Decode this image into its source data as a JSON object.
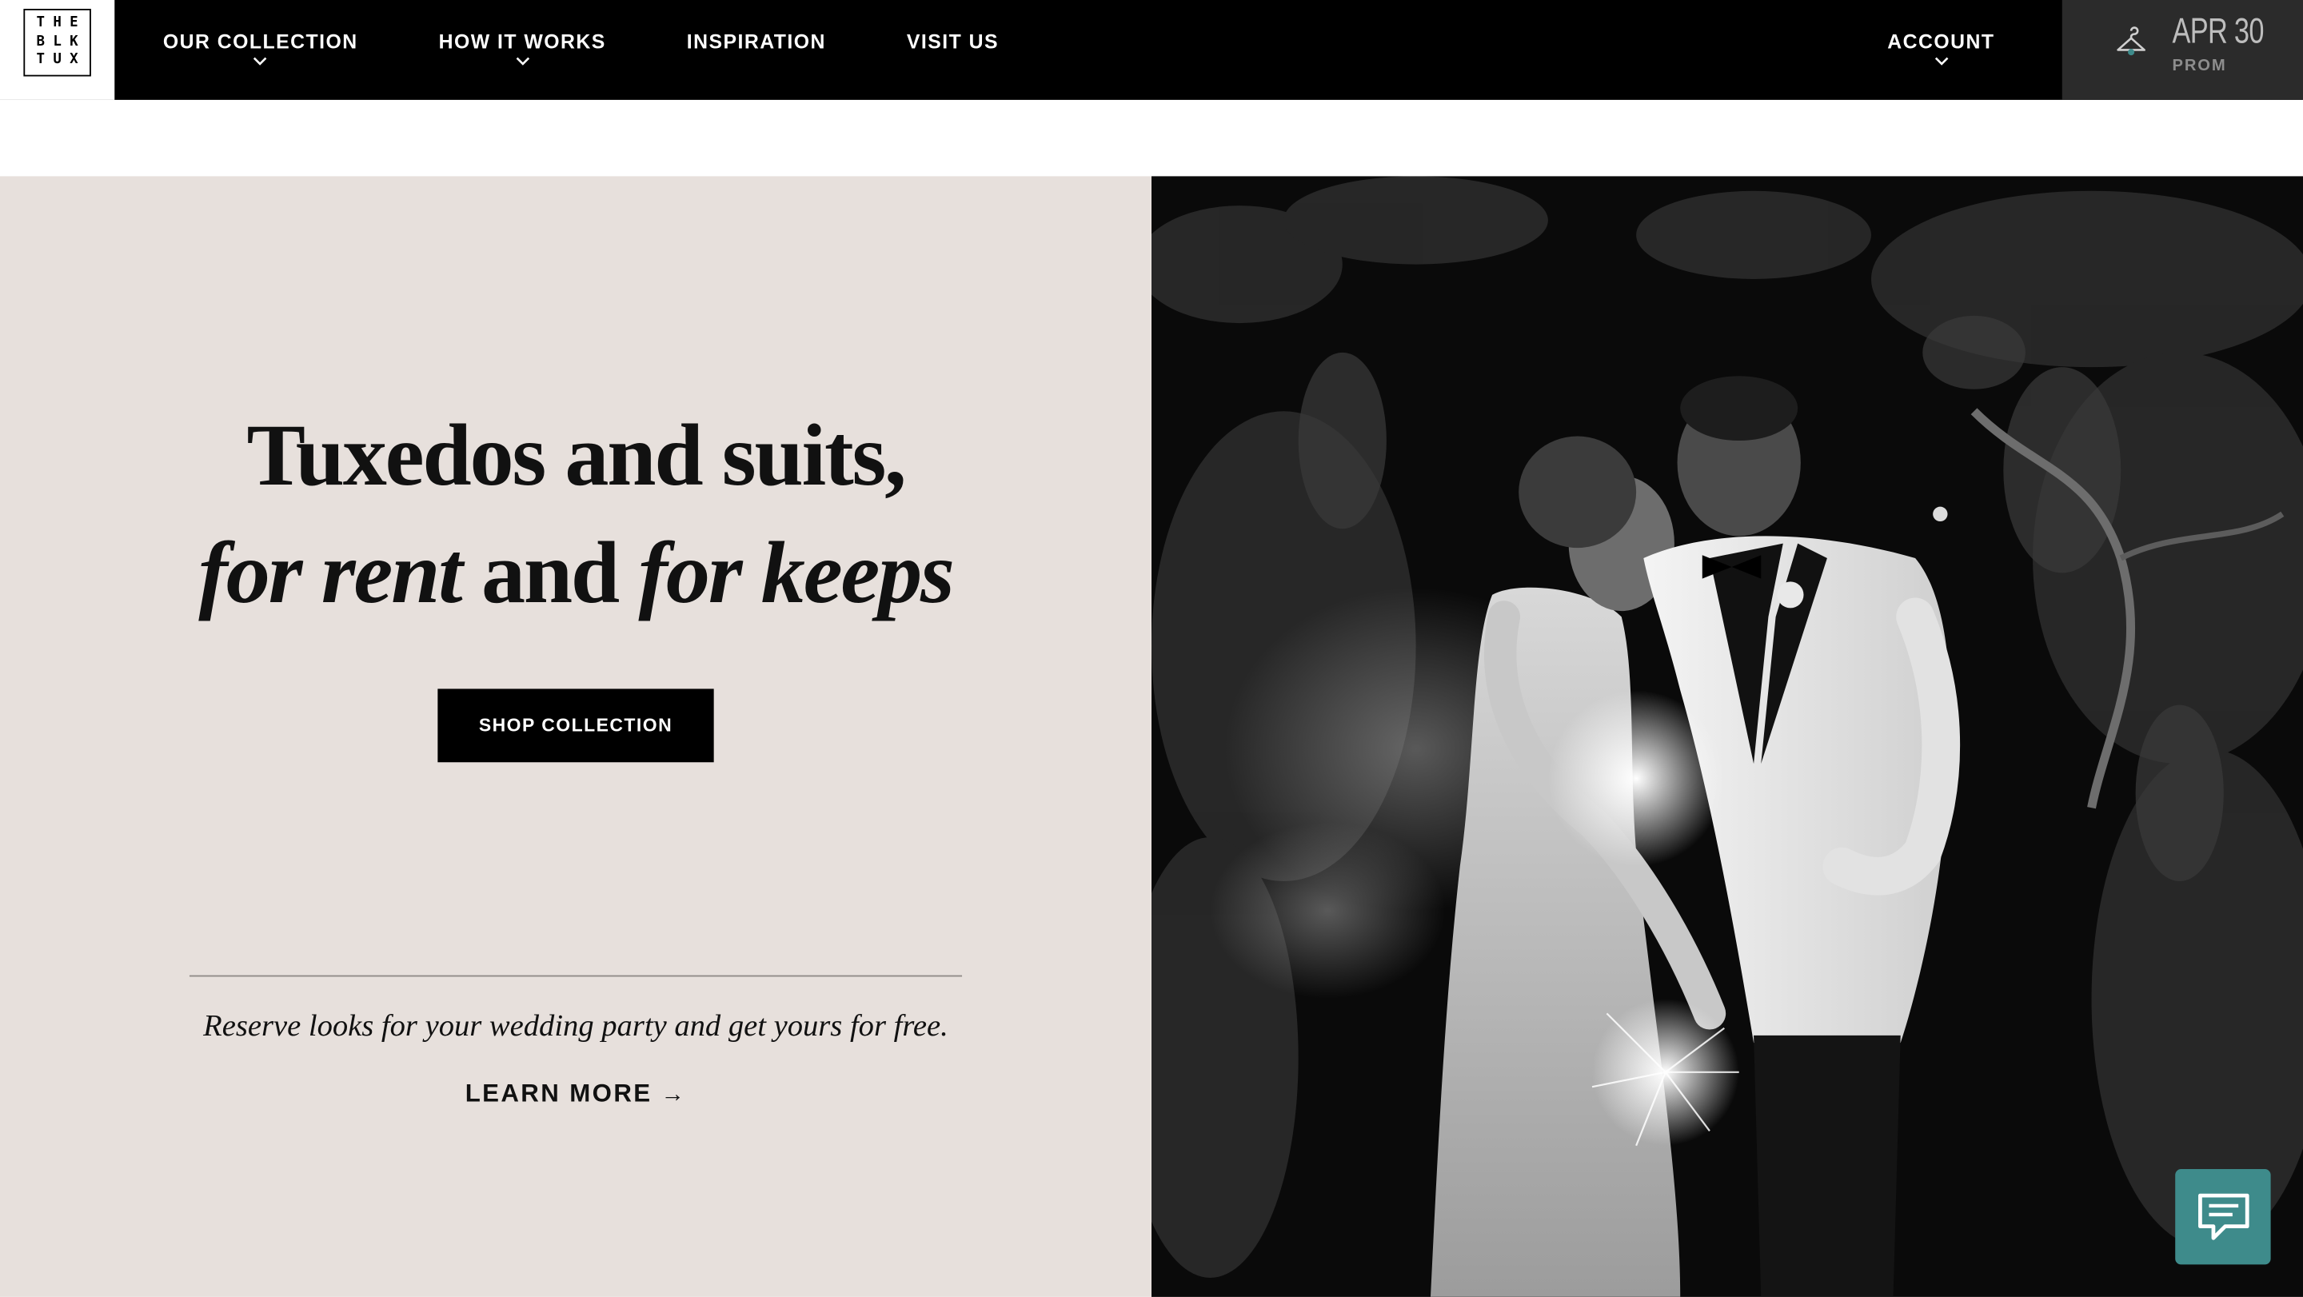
{
  "logo": {
    "letters": [
      "T",
      "H",
      "E",
      "B",
      "L",
      "K",
      "T",
      "U",
      "X"
    ]
  },
  "nav": {
    "items": [
      {
        "label": "OUR COLLECTION",
        "has_dropdown": true
      },
      {
        "label": "HOW IT WORKS",
        "has_dropdown": true
      },
      {
        "label": "INSPIRATION",
        "has_dropdown": false
      },
      {
        "label": "VISIT US",
        "has_dropdown": false
      }
    ],
    "account_label": "ACCOUNT"
  },
  "event": {
    "icon": "hanger-icon",
    "date": "APR 30",
    "type": "PROM"
  },
  "hero": {
    "headline_line1": "Tuxedos and suits,",
    "headline_line2_part1": "for rent",
    "headline_line2_part2": " and ",
    "headline_line2_part3": "for keeps",
    "cta_label": "SHOP COLLECTION",
    "promo_text": "Reserve looks for your wedding party and get yours for free.",
    "learn_more_label": "LEARN MORE",
    "learn_more_arrow": "→"
  },
  "chat": {
    "icon": "chat-icon"
  },
  "colors": {
    "nav_bg": "#000000",
    "event_bg": "#2b2b2b",
    "hero_left_bg": "#e7e0dc",
    "chat_accent": "#3e8b8b"
  }
}
